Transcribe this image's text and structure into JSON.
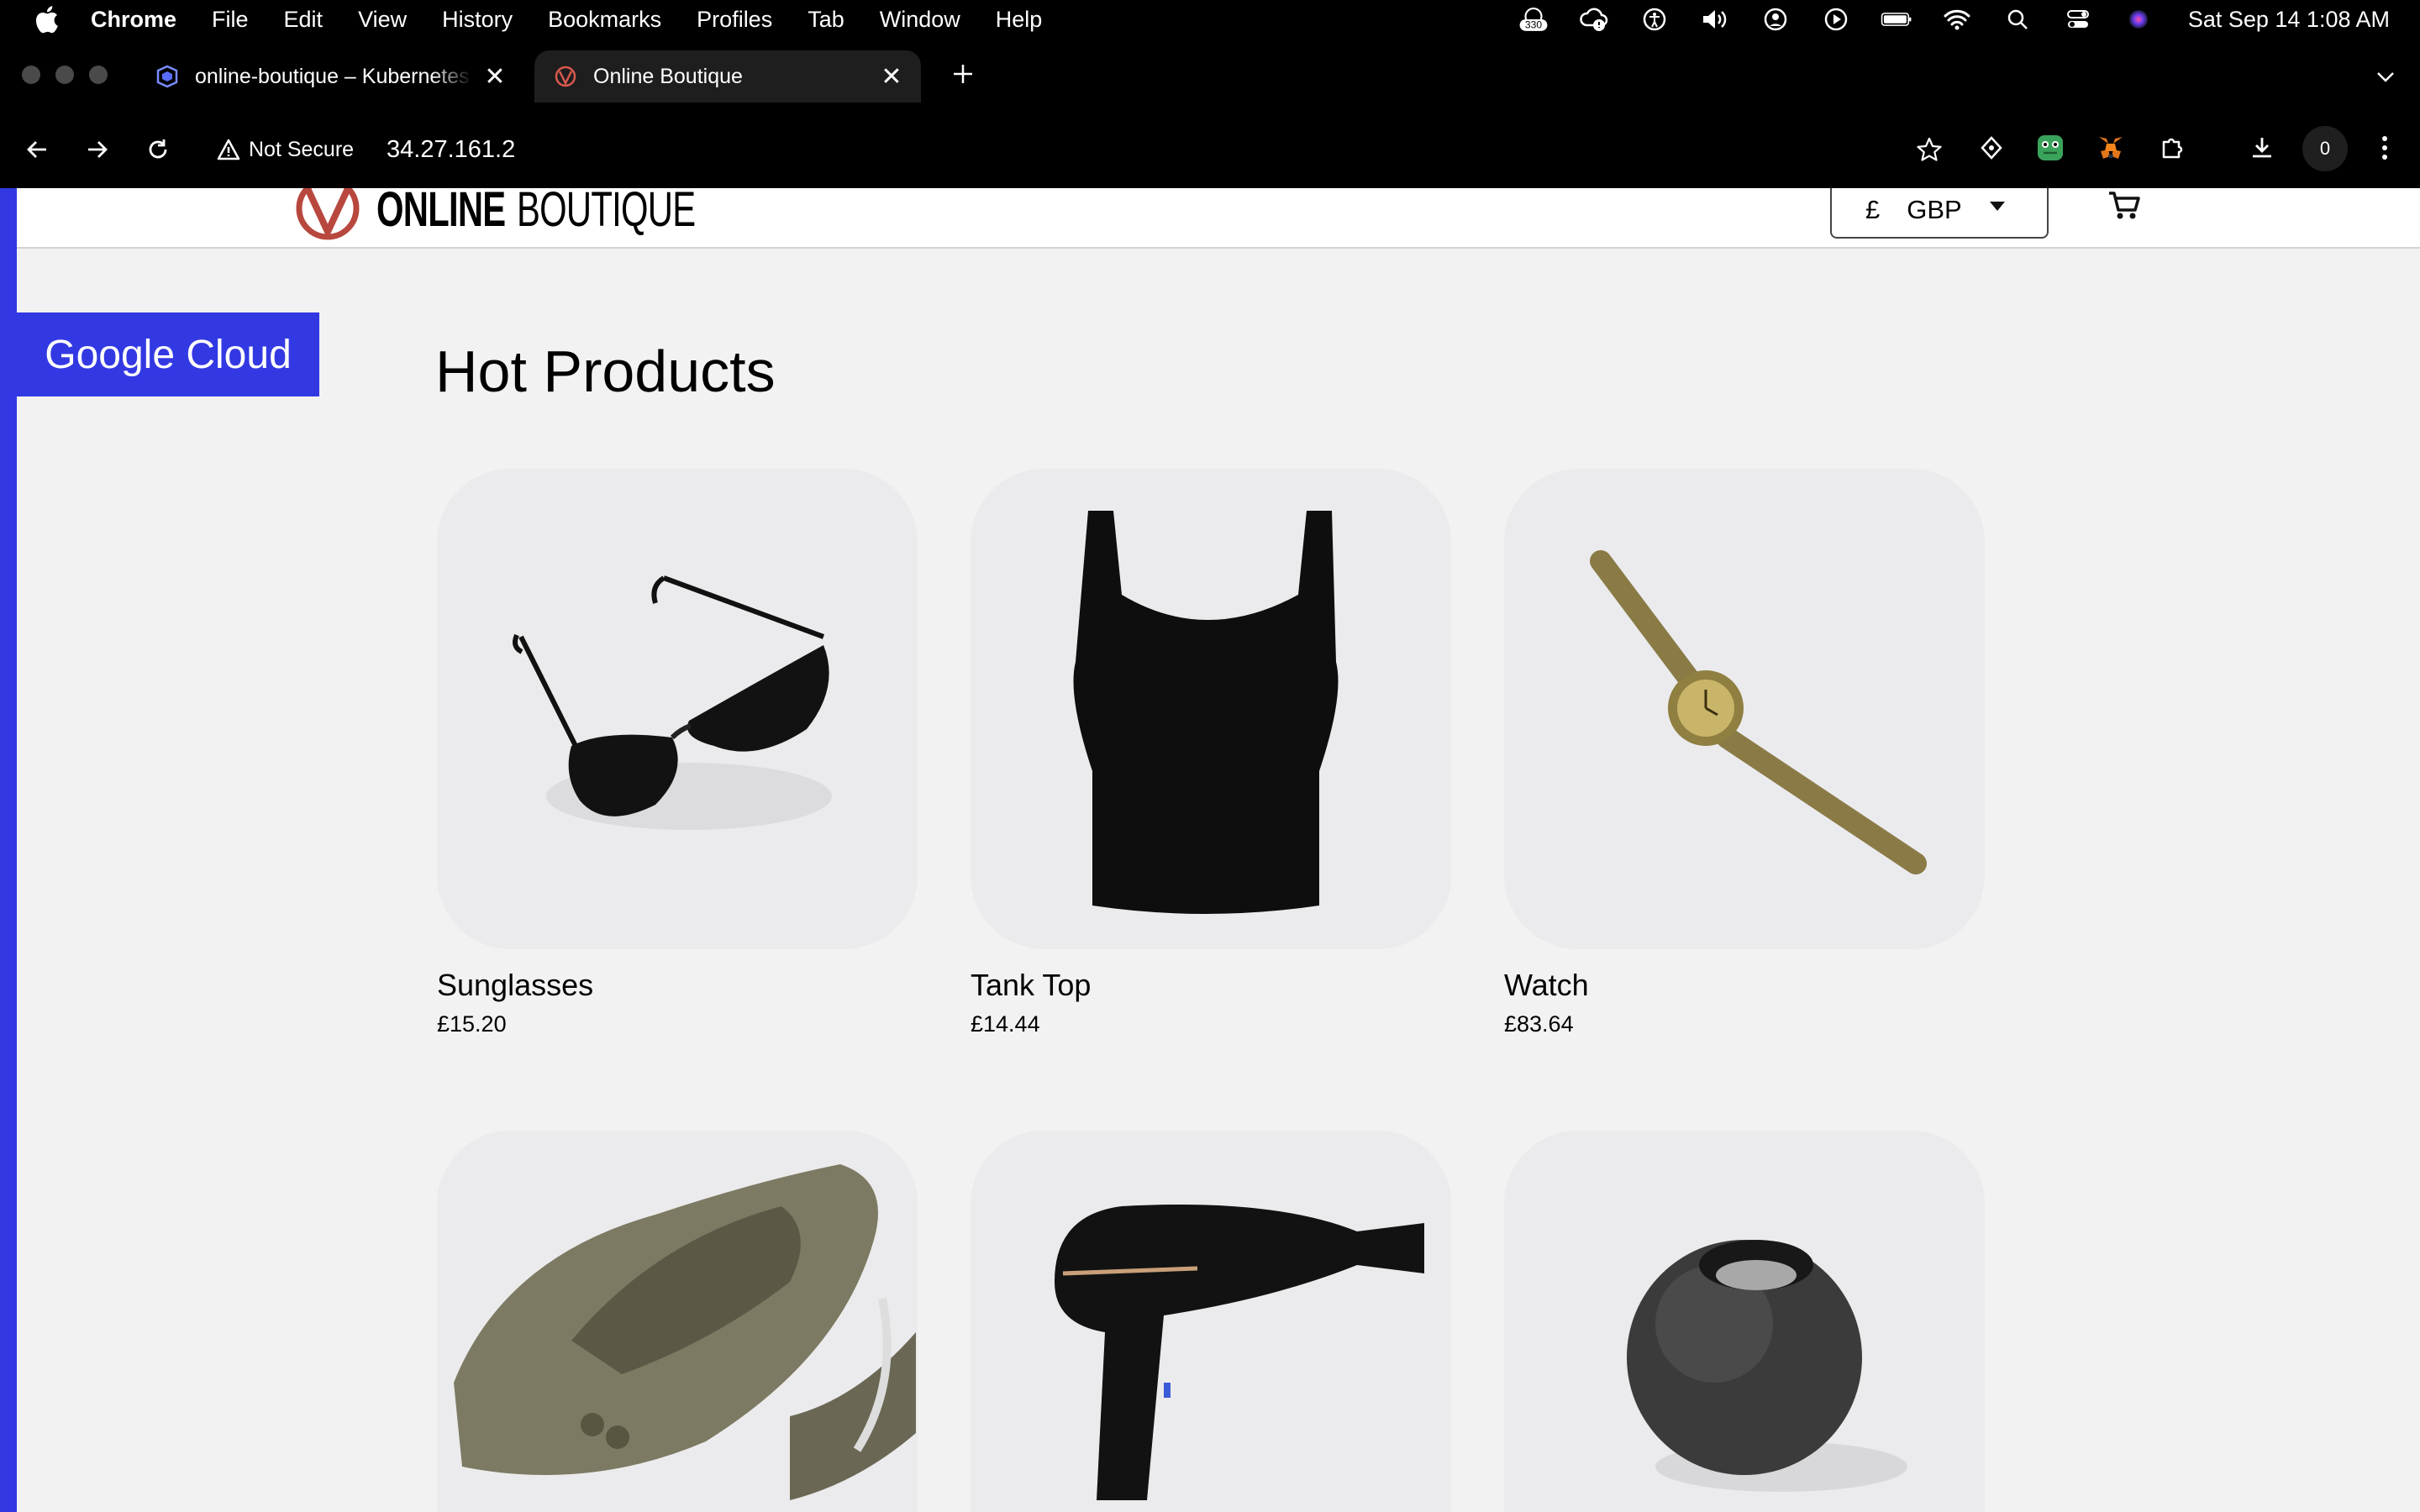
{
  "menubar": {
    "app": "Chrome",
    "items": [
      "File",
      "Edit",
      "View",
      "History",
      "Bookmarks",
      "Profiles",
      "Tab",
      "Window",
      "Help"
    ],
    "notification_count": "330",
    "clock": "Sat Sep 14  1:08 AM"
  },
  "tabs": [
    {
      "title": "online-boutique – Kubernetes",
      "icon": "kubernetes-icon"
    },
    {
      "title": "Online Boutique",
      "icon": "boutique-icon"
    }
  ],
  "toolbar": {
    "security_label": "Not Secure",
    "url": "34.27.161.2",
    "downloads_count": "0"
  },
  "site": {
    "logo_bold": "ONLINE",
    "logo_light": "BOUTIQUE",
    "currency_symbol": "£",
    "currency_code": "GBP",
    "banner": "Google Cloud",
    "section_title": "Hot Products",
    "products": [
      {
        "name": "Sunglasses",
        "price": "£15.20"
      },
      {
        "name": "Tank Top",
        "price": "£14.44"
      },
      {
        "name": "Watch",
        "price": "£83.64"
      },
      {
        "name": "",
        "price": ""
      },
      {
        "name": "",
        "price": ""
      },
      {
        "name": "",
        "price": ""
      }
    ]
  },
  "colors": {
    "brand_blue": "#3339e2",
    "logo_red": "#b8483e",
    "page_bg": "#f2f2f2"
  }
}
